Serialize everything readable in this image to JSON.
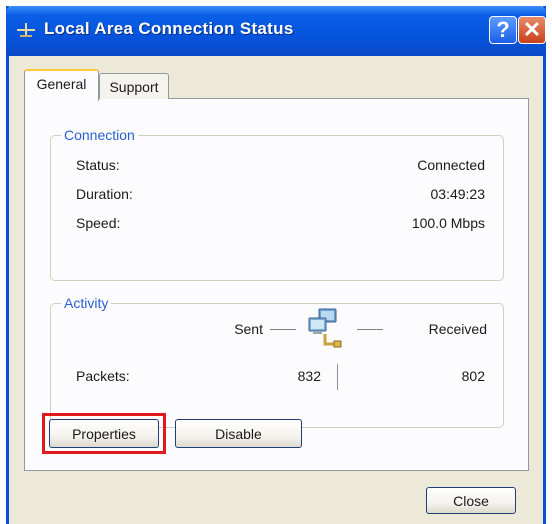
{
  "window": {
    "title": "Local Area Connection Status",
    "help_label": "?",
    "close_label": "✕"
  },
  "tabs": [
    {
      "label": "General",
      "selected": true
    },
    {
      "label": "Support",
      "selected": false
    }
  ],
  "connection": {
    "group_label": "Connection",
    "status_label": "Status:",
    "status_value": "Connected",
    "duration_label": "Duration:",
    "duration_value": "03:49:23",
    "speed_label": "Speed:",
    "speed_value": "100.0 Mbps"
  },
  "activity": {
    "group_label": "Activity",
    "sent_label": "Sent",
    "received_label": "Received",
    "packets_label": "Packets:",
    "packets_sent": "832",
    "packets_received": "802",
    "icon": "network-connection-icon"
  },
  "buttons": {
    "properties_label": "Properties",
    "disable_label": "Disable",
    "close_label": "Close"
  },
  "colors": {
    "titlebar": "#0654dd",
    "highlight": "#e0191e",
    "group_label": "#2a5fd0"
  }
}
